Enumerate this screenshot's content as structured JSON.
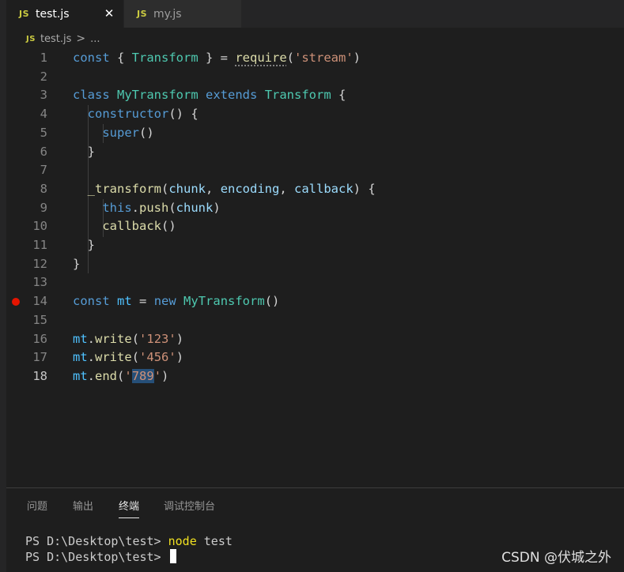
{
  "tabs": [
    {
      "icon": "JS",
      "label": "test.js",
      "active": true
    },
    {
      "icon": "JS",
      "label": "my.js",
      "active": false
    }
  ],
  "tab_close": "✕",
  "breadcrumb": {
    "icon": "JS",
    "file": "test.js",
    "sep": ">",
    "rest": "..."
  },
  "editor": {
    "current_line": 18,
    "breakpoint_line": 14,
    "lines": [
      [
        [
          "kw",
          "const"
        ],
        [
          "pn",
          " { "
        ],
        [
          "cls",
          "Transform"
        ],
        [
          "pn",
          " } = "
        ],
        [
          "fn squig",
          "require"
        ],
        [
          "pn",
          "("
        ],
        [
          "str",
          "'stream'"
        ],
        [
          "pn",
          ")"
        ]
      ],
      [],
      [
        [
          "kw",
          "class"
        ],
        [
          "pn",
          " "
        ],
        [
          "cls",
          "MyTransform"
        ],
        [
          "pn",
          " "
        ],
        [
          "kw",
          "extends"
        ],
        [
          "pn",
          " "
        ],
        [
          "cls",
          "Transform"
        ],
        [
          "pn",
          " {"
        ]
      ],
      [
        [
          "pn",
          "  "
        ],
        [
          "kw",
          "constructor"
        ],
        [
          "pn",
          "() {"
        ]
      ],
      [
        [
          "pn",
          "    "
        ],
        [
          "kw",
          "super"
        ],
        [
          "pn",
          "()"
        ]
      ],
      [
        [
          "pn",
          "  }"
        ]
      ],
      [],
      [
        [
          "pn",
          "  "
        ],
        [
          "fn",
          "_transform"
        ],
        [
          "pn",
          "("
        ],
        [
          "var",
          "chunk"
        ],
        [
          "pn",
          ", "
        ],
        [
          "var",
          "encoding"
        ],
        [
          "pn",
          ", "
        ],
        [
          "var",
          "callback"
        ],
        [
          "pn",
          ") {"
        ]
      ],
      [
        [
          "pn",
          "    "
        ],
        [
          "kw",
          "this"
        ],
        [
          "pn",
          "."
        ],
        [
          "fn",
          "push"
        ],
        [
          "pn",
          "("
        ],
        [
          "var",
          "chunk"
        ],
        [
          "pn",
          ")"
        ]
      ],
      [
        [
          "pn",
          "    "
        ],
        [
          "fn",
          "callback"
        ],
        [
          "pn",
          "()"
        ]
      ],
      [
        [
          "pn",
          "  }"
        ]
      ],
      [
        [
          "pn",
          "}"
        ]
      ],
      [],
      [
        [
          "kw",
          "const"
        ],
        [
          "pn",
          " "
        ],
        [
          "vconst",
          "mt"
        ],
        [
          "pn",
          " = "
        ],
        [
          "kw",
          "new"
        ],
        [
          "pn",
          " "
        ],
        [
          "cls",
          "MyTransform"
        ],
        [
          "pn",
          "()"
        ]
      ],
      [],
      [
        [
          "vconst",
          "mt"
        ],
        [
          "pn",
          "."
        ],
        [
          "fn",
          "write"
        ],
        [
          "pn",
          "("
        ],
        [
          "str",
          "'123'"
        ],
        [
          "pn",
          ")"
        ]
      ],
      [
        [
          "vconst",
          "mt"
        ],
        [
          "pn",
          "."
        ],
        [
          "fn",
          "write"
        ],
        [
          "pn",
          "("
        ],
        [
          "str",
          "'456'"
        ],
        [
          "pn",
          ")"
        ]
      ],
      [
        [
          "vconst",
          "mt"
        ],
        [
          "pn",
          "."
        ],
        [
          "fn",
          "end"
        ],
        [
          "pn",
          "("
        ],
        [
          "str",
          "'"
        ],
        [
          "sel",
          "789"
        ],
        [
          "str",
          "'"
        ],
        [
          "pn",
          ")"
        ]
      ]
    ]
  },
  "panel": {
    "tabs": [
      {
        "label": "问题",
        "active": false
      },
      {
        "label": "输出",
        "active": false
      },
      {
        "label": "终端",
        "active": true
      },
      {
        "label": "调试控制台",
        "active": false
      }
    ],
    "terminal": [
      {
        "prompt": "PS D:\\Desktop\\test> ",
        "command": "node",
        "args": " test"
      },
      {
        "prompt": "PS D:\\Desktop\\test> ",
        "command": "",
        "args": "",
        "cursor": true
      }
    ]
  },
  "watermark": "CSDN @伏城之外",
  "colors": {
    "background": "#1e1e1e",
    "keyword": "#569cd6",
    "class": "#4ec9b0",
    "function": "#dcdcaa",
    "string": "#ce9178",
    "breakpoint": "#e51400"
  }
}
